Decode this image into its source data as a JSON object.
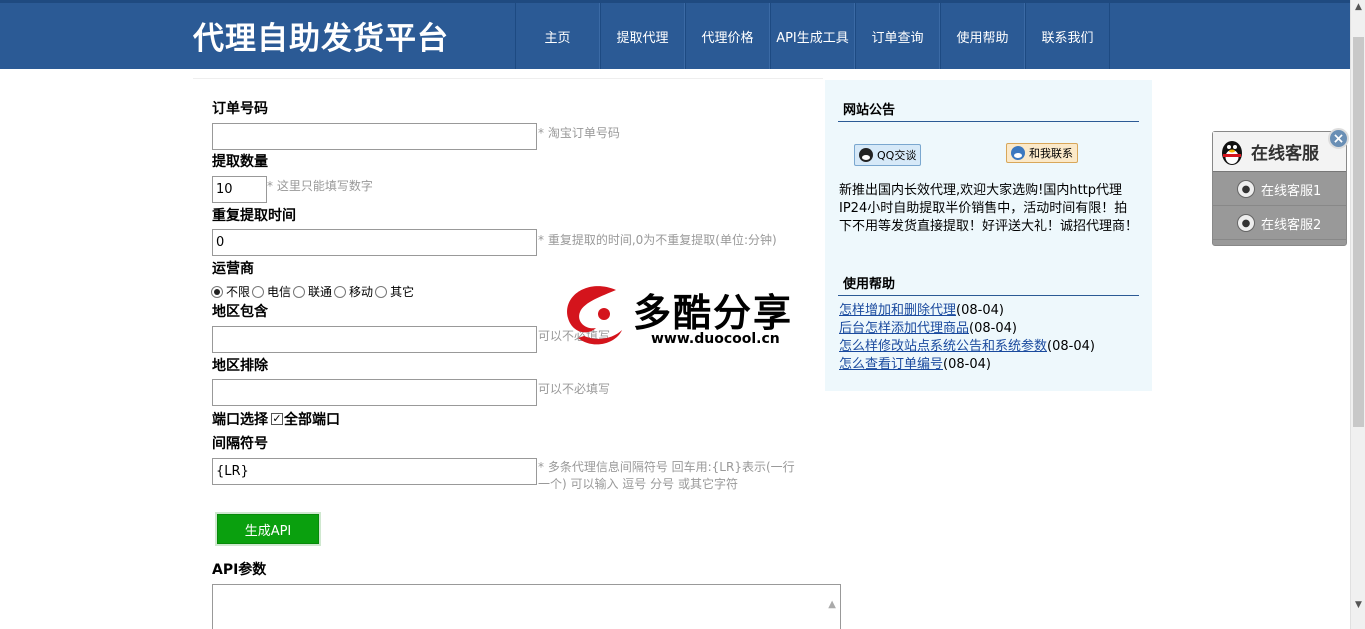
{
  "header": {
    "logo": "代理自助发货平台",
    "nav": [
      "主页",
      "提取代理",
      "代理价格",
      "API生成工具",
      "订单查询",
      "使用帮助",
      "联系我们"
    ]
  },
  "form": {
    "order_label": "订单号码",
    "order_value": "",
    "order_hint": "* 淘宝订单号码",
    "qty_label": "提取数量",
    "qty_value": "10",
    "qty_hint": "* 这里只能填写数字",
    "repeat_label": "重复提取时间",
    "repeat_value": "0",
    "repeat_hint": "* 重复提取的时间,0为不重复提取(单位:分钟)",
    "carrier_label": "运营商",
    "carriers": [
      "不限",
      "电信",
      "联通",
      "移动",
      "其它"
    ],
    "carrier_selected": "不限",
    "region_incl_label": "地区包含",
    "region_incl_hint": "可以不必填写",
    "region_excl_label": "地区排除",
    "region_excl_hint": "可以不必填写",
    "port_label": "端口选择",
    "port_all_label": "全部端口",
    "sep_label": "间隔符号",
    "sep_value": "{LR}",
    "sep_hint": "* 多条代理信息间隔符号 回车用:{LR}表示(一行一个) 可以输入 逗号 分号 或其它字符",
    "gen_button": "生成API",
    "api_label": "API参数"
  },
  "sidebar": {
    "notice_title": "网站公告",
    "qq_btn": "QQ交谈",
    "contact_btn": "和我联系",
    "notice_text": "新推出国内长效代理,欢迎大家选购!国内http代理IP24小时自助提取半价销售中，活动时间有限！拍下不用等发货直接提取！好评送大礼！诚招代理商！",
    "help_title": "使用帮助",
    "help_items": [
      {
        "text": "怎样增加和删除代理",
        "date": "(08-04)"
      },
      {
        "text": "后台怎样添加代理商品",
        "date": "(08-04)"
      },
      {
        "text": "怎么样修改站点系统公告和系统参数",
        "date": "(08-04)"
      },
      {
        "text": "怎么查看订单编号",
        "date": "(08-04)"
      }
    ]
  },
  "watermark": {
    "title": "多酷分享",
    "url": "www.duocool.cn"
  },
  "service": {
    "title": "在线客服",
    "items": [
      "在线客服1",
      "在线客服2"
    ]
  },
  "colors": {
    "header_bg": "#2b5a95",
    "button_green": "#0aa00e",
    "sidebar_bg": "#eef8fc",
    "link": "#1a4a9e"
  }
}
